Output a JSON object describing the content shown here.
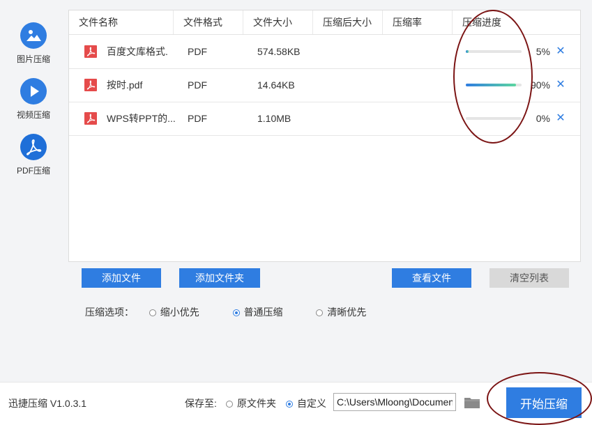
{
  "sidebar": {
    "items": [
      {
        "label": "图片压缩",
        "icon": "image-icon"
      },
      {
        "label": "视频压缩",
        "icon": "play-icon"
      },
      {
        "label": "PDF压缩",
        "icon": "pdf-icon",
        "active": true
      }
    ]
  },
  "table": {
    "headers": [
      "文件名称",
      "文件格式",
      "文件大小",
      "压缩后大小",
      "压缩率",
      "压缩进度"
    ],
    "rows": [
      {
        "name": "百度文库格式.",
        "format": "PDF",
        "size": "574.58KB",
        "compressed_size": "",
        "ratio": "",
        "progress_label": "5%",
        "progress": 0.05
      },
      {
        "name": "按时.pdf",
        "format": "PDF",
        "size": "14.64KB",
        "compressed_size": "",
        "ratio": "",
        "progress_label": "90%",
        "progress": 0.9
      },
      {
        "name": "WPS转PPT的...",
        "format": "PDF",
        "size": "1.10MB",
        "compressed_size": "",
        "ratio": "",
        "progress_label": "0%",
        "progress": 0
      }
    ],
    "remove_glyph": "✕"
  },
  "actions": {
    "add_file": "添加文件",
    "add_folder": "添加文件夹",
    "view_files": "查看文件",
    "clear_list": "清空列表"
  },
  "options": {
    "label": "压缩选项：",
    "choices": [
      "缩小优先",
      "普通压缩",
      "清晰优先"
    ],
    "selected_index": 1
  },
  "footer": {
    "version": "迅捷压缩 V1.0.3.1",
    "save_to_label": "保存至:",
    "save_choices": [
      "原文件夹",
      "自定义"
    ],
    "save_selected_index": 1,
    "path_value": "C:\\Users\\Mloong\\Documents",
    "start_button": "开始压缩"
  },
  "colors": {
    "accent": "#2f7de1",
    "annotation": "#7b1414"
  }
}
